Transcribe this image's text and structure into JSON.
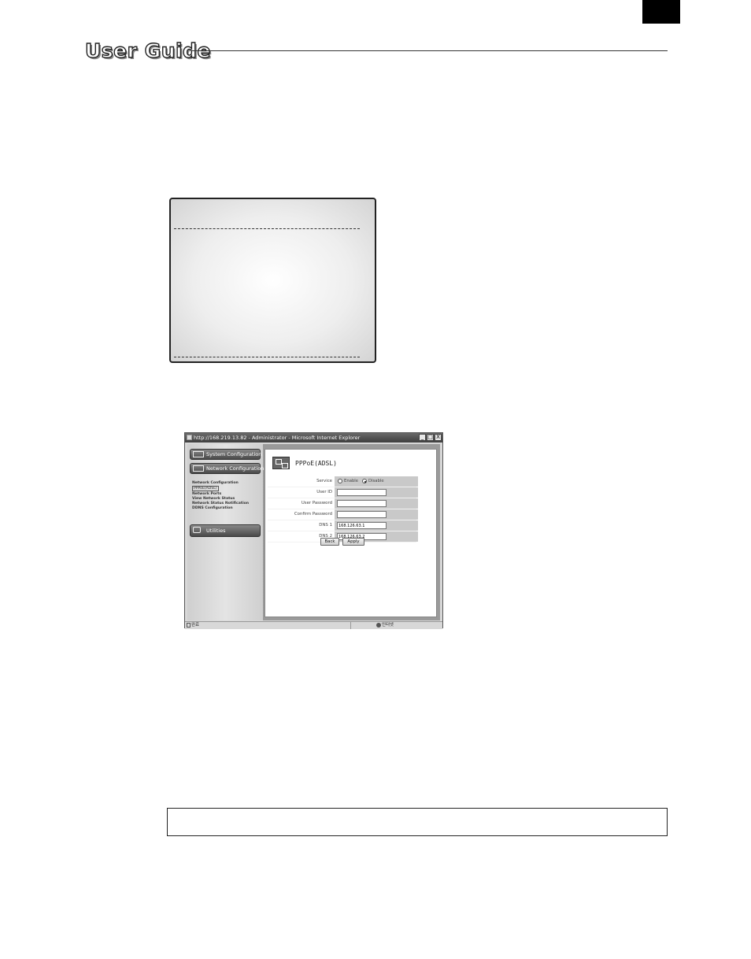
{
  "header": {
    "title": "User Guide"
  },
  "browser": {
    "window_title": "http://168.219.13.82 - Administrator - Microsoft Internet Explorer",
    "window_controls": [
      "_",
      "□",
      "X"
    ],
    "sidebar": {
      "system_config_label": "System Configuration",
      "network_config_label": "Network Configuration",
      "links": [
        "Network Configuration",
        "PPPoE(ADSL)",
        "Network Ports",
        "View Network Status",
        "Network Status Notification",
        "DDNS Configuration"
      ],
      "utilities_label": "Utilities"
    },
    "page": {
      "title": "PPPoE(ADSL)",
      "service": {
        "label": "Service",
        "enable": "Enable",
        "disable": "Disable",
        "selected": "Disable"
      },
      "user_id": {
        "label": "User ID",
        "value": ""
      },
      "user_password": {
        "label": "User Password",
        "value": ""
      },
      "confirm_password": {
        "label": "Confirm Password",
        "value": ""
      },
      "dns1": {
        "label": "DNS 1",
        "value": "168.126.63.1"
      },
      "dns2": {
        "label": "DNS 2",
        "value": "168.126.63.2"
      },
      "back_label": "Back",
      "apply_label": "Apply"
    },
    "status": {
      "left": "완료",
      "right": "인터넷"
    }
  },
  "icons": {
    "system_config": "monitor-icon",
    "network_config": "network-icon",
    "utilities": "tools-icon",
    "page": "network-icon"
  }
}
